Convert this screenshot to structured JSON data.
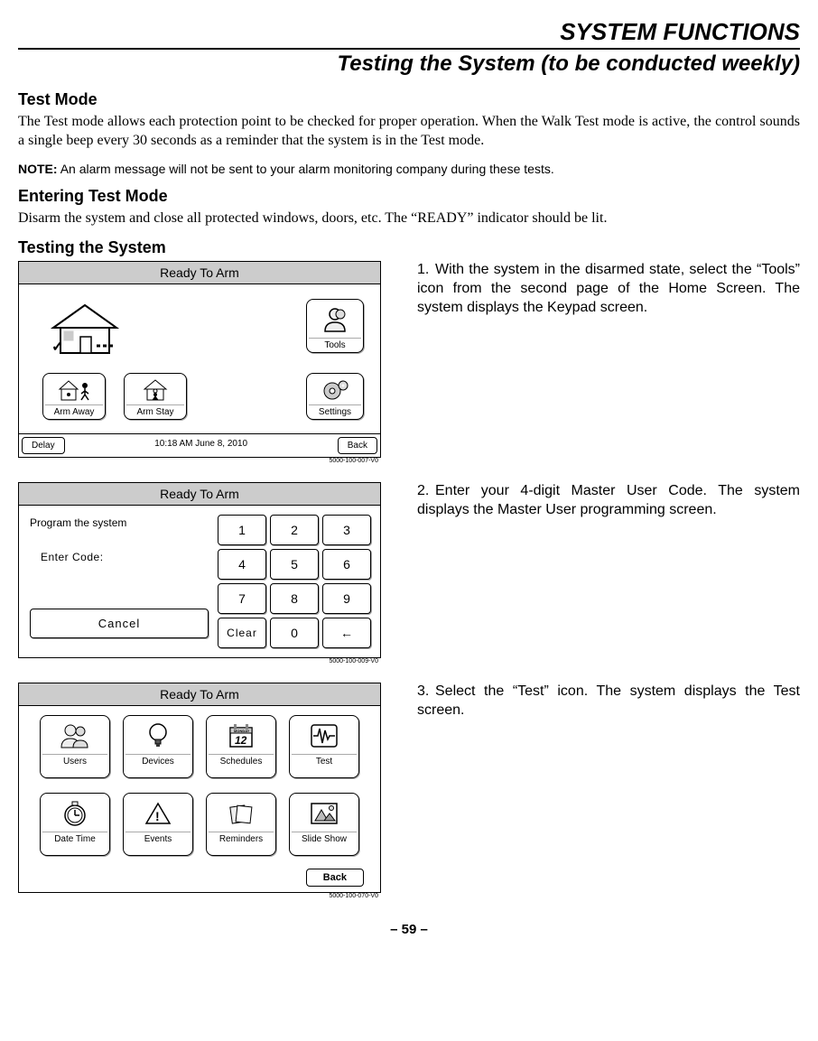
{
  "header": {
    "title": "SYSTEM FUNCTIONS",
    "subtitle": "Testing the System (to be conducted weekly)"
  },
  "intro": {
    "heading1": "Test Mode",
    "para1": "The Test mode allows each protection point to be checked for proper operation. When the Walk Test mode is active, the control sounds a single beep every 30 seconds as a reminder that the system is in the Test mode.",
    "note_label": "NOTE:",
    "note_text": "An alarm message will not be sent to your alarm monitoring company during these tests.",
    "heading2": "Entering Test Mode",
    "para2": "Disarm the system and close all protected windows, doors, etc. The “READY” indicator should be lit.",
    "heading3": "Testing the System"
  },
  "steps": {
    "s1": "With the system in the disarmed state, select the “Tools” icon from the second page of the Home Screen. The system displays the Keypad screen.",
    "s2": "Enter your 4-digit Master User Code. The system displays the Master User programming screen.",
    "s3": "Select the “Test” icon. The system displays the Test screen."
  },
  "screen1": {
    "title": "Ready To Arm",
    "tools": "Tools",
    "arm_away": "Arm Away",
    "arm_stay": "Arm Stay",
    "settings": "Settings",
    "delay": "Delay",
    "datetime": "10:18 AM  June 8,  2010",
    "back": "Back",
    "ref": "5000-100-007-V0"
  },
  "screen2": {
    "title": "Ready To Arm",
    "prompt1": "Program the system",
    "prompt2": "Enter Code:",
    "cancel": "Cancel",
    "keys": [
      "1",
      "2",
      "3",
      "4",
      "5",
      "6",
      "7",
      "8",
      "9",
      "Clear",
      "0",
      "←"
    ],
    "ref": "5000-100-009-V0"
  },
  "screen3": {
    "title": "Ready To Arm",
    "icons": [
      "Users",
      "Devices",
      "Schedules",
      "Test",
      "Date Time",
      "Events",
      "Reminders",
      "Slide Show"
    ],
    "back": "Back",
    "ref": "5000-100-070-V0"
  },
  "page_num": "– 59 –"
}
